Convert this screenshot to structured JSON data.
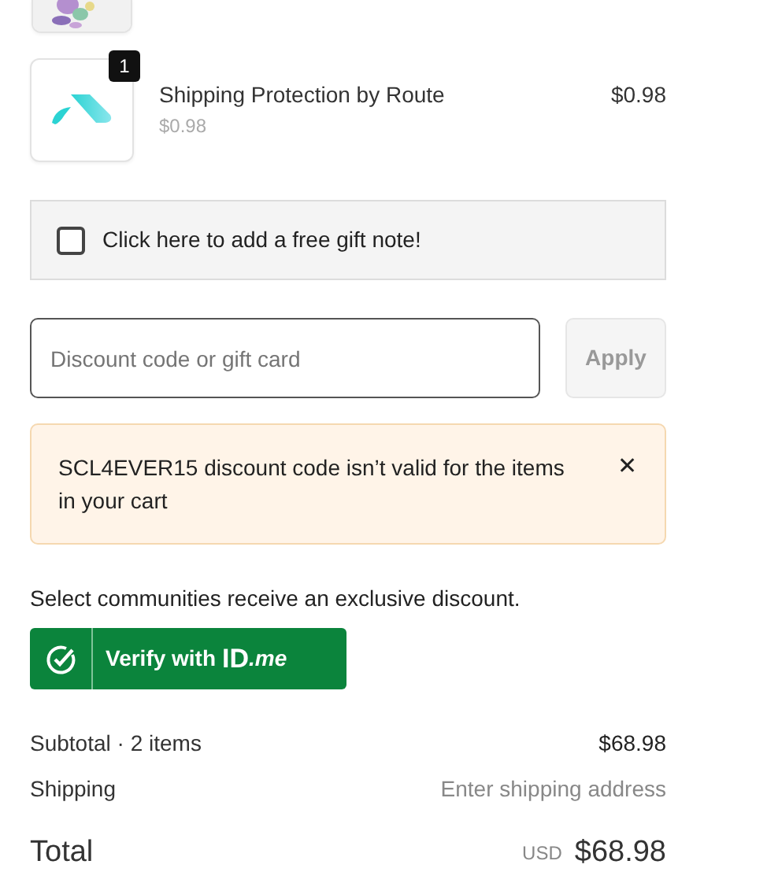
{
  "items": [
    {
      "kind": "picture"
    },
    {
      "kind": "route",
      "name": "Shipping Protection by Route",
      "quantity": "1",
      "price": "$0.98",
      "unit_price": "$0.98"
    }
  ],
  "gift_note": {
    "label": "Click here to add a free gift note!",
    "checked": false
  },
  "discount": {
    "placeholder": "Discount code or gift card",
    "button": "Apply",
    "disabled": true
  },
  "error": {
    "message": "SCL4EVER15 discount code isn’t valid for the items in your cart",
    "close": "✕"
  },
  "communities": {
    "text": "Select communities receive an exclusive discount.",
    "button": "Verify with",
    "logo_main": "ID",
    "logo_suffix": ".me"
  },
  "summary": [
    {
      "label": "Subtotal · 2 items",
      "value": "$68.98",
      "muted": false
    },
    {
      "label": "Shipping",
      "value": "Enter shipping address",
      "muted": true
    }
  ],
  "total": {
    "label": "Total",
    "currency": "USD",
    "value": "$68.98"
  }
}
